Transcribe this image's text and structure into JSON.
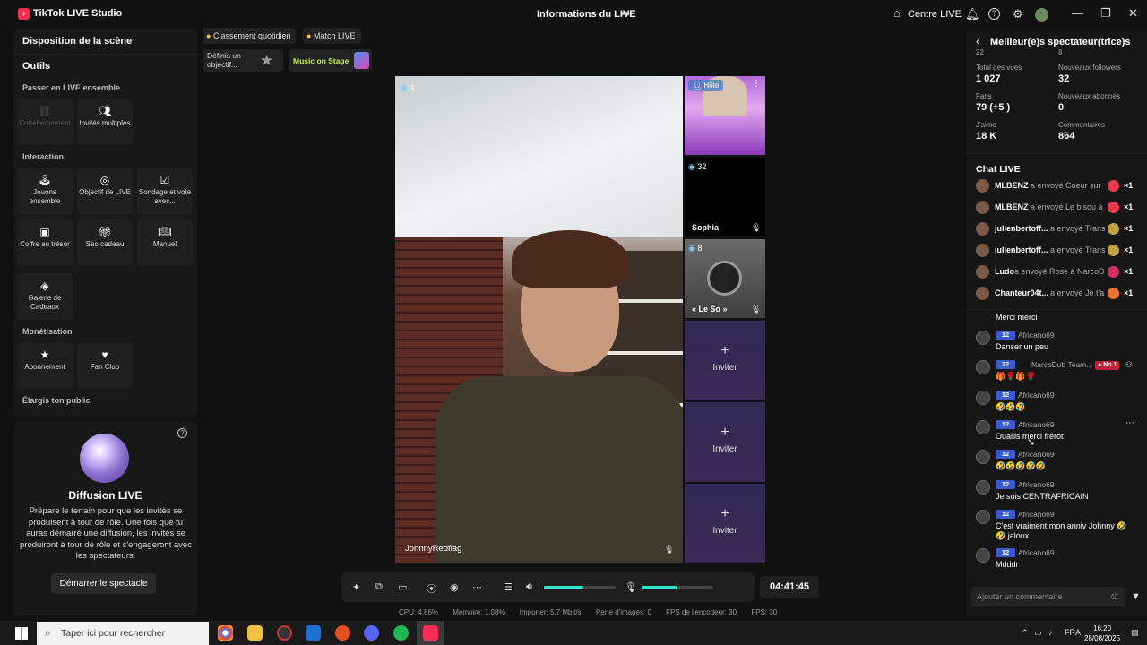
{
  "titlebar": {
    "app_title": "TikTok LIVE Studio",
    "center_title": "Informations du LIVE",
    "centre_live": "Centre LIVE"
  },
  "left": {
    "scene_layout": "Disposition de la scène",
    "tools_title": "Outils",
    "sections": {
      "ensemble": "Passer en LIVE ensemble",
      "interaction": "Interaction",
      "monetisation": "Monétisation",
      "public": "Élargis ton public"
    },
    "tools": {
      "cohost": "Cohébergement",
      "multi": "Invités multiples",
      "play": "Jouons ensemble",
      "goal": "Objectif de LIVE",
      "poll": "Sondage et vote avec...",
      "chest": "Coffre au trésor",
      "giftbag": "Sac-cadeau",
      "manual": "Manuel",
      "gallery": "Galerie de Cadeaux",
      "subscription": "Abonnement",
      "fanclub": "Fan Club"
    },
    "diffusion": {
      "title": "Diffusion LIVE",
      "text": "Prépare le terrain pour que les invités se produisent à tour de rôle. Une fois que tu auras démarré une diffusion, les invités se produiront à tour de rôle et s'engageront avec les spectateurs.",
      "button": "Démarrer le spectacle"
    }
  },
  "top": {
    "ranking": "Classement quotidien",
    "match": "Match LIVE",
    "goal_card": "Définis un objectif...",
    "music": "Music on Stage"
  },
  "stage": {
    "main": {
      "count": "4",
      "name": "JohnnyRedflag"
    },
    "host_label": "Hôte",
    "guest2": {
      "count": "32",
      "name": "Sophia"
    },
    "guest3": {
      "count": "8",
      "name": "« Le So »"
    },
    "invite": "Inviter",
    "plus": "+"
  },
  "controls": {
    "timer": "04:41:45",
    "volume": 0.55,
    "mic": 0.5
  },
  "stats": {
    "cpu": "CPU:  4.86%",
    "memory": "Mémoire:  1.08%",
    "importer": "Importer:  5.7 Mbit/s",
    "frame_loss": "Perte d'images:  0",
    "encoder_fps": "FPS de l'encodeur:  30",
    "fps": "FPS:  30"
  },
  "right": {
    "title": "Meilleur(e)s spectateur(trice)s",
    "partial_a": "22",
    "partial_b": "8",
    "stats": [
      {
        "label": "Total des vues",
        "value": "1 027"
      },
      {
        "label": "Nouveaux followers",
        "value": "32"
      },
      {
        "label": "Fans",
        "value": "79 (+5 )"
      },
      {
        "label": "Nouveaux abonnés",
        "value": "0"
      },
      {
        "label": "J'aime",
        "value": "18 K"
      },
      {
        "label": "Commentaires",
        "value": "864"
      }
    ],
    "chat_title": "Chat LIVE",
    "gifts": [
      {
        "name": "MLBENZ",
        "text": "a envoyé Coeur sur",
        "mult": "×1",
        "color": "#e83a4a"
      },
      {
        "name": "MLBENZ",
        "text": "a envoyé Le bisou à",
        "mult": "×1",
        "color": "#e83a4a"
      },
      {
        "name": "julienbertoff...",
        "text": "a envoyé Trans",
        "mult": "×1",
        "color": "#c0a040"
      },
      {
        "name": "julienbertoff...",
        "text": "a envoyé Trans",
        "mult": "×1",
        "color": "#c0a040"
      },
      {
        "name": "Ludo",
        "text": "a envoyé Rose à NarcoD",
        "mult": "×1",
        "color": "#d03060"
      },
      {
        "name": "Chanteur04t...",
        "text": "a envoyé Je t'a",
        "mult": "×1",
        "color": "#f07030"
      }
    ],
    "messages": [
      {
        "text": "Merci merci"
      },
      {
        "badge": "12",
        "name": "Africano69",
        "text": "Danser un peu"
      },
      {
        "badge": "22",
        "name": "NarcoDub Team...",
        "text": "🎁🌹🎁🌹",
        "no1": "No.1"
      },
      {
        "badge": "12",
        "name": "Africano69",
        "text": "🤣🤣🤣"
      },
      {
        "badge": "12",
        "name": "Africano69",
        "text": "Ouaiiis merci frérot"
      },
      {
        "badge": "12",
        "name": "Africano69",
        "text": "🤣🤣🤣🤣🤣"
      },
      {
        "badge": "12",
        "name": "Africano69",
        "text": "Je suis CENTRAFRICAIN"
      },
      {
        "badge": "12",
        "name": "Africano69",
        "text": "C'est vraiment mon anniv Johnny 🤣",
        "text2": "🤣 jaloux"
      },
      {
        "badge": "12",
        "name": "Africano69",
        "text": "Mdddr"
      }
    ],
    "comment_placeholder": "Ajouter un commentaire"
  },
  "taskbar": {
    "search": "Taper ici pour rechercher",
    "lang": "FRA",
    "time": "16:20",
    "date": "28/08/2025"
  }
}
